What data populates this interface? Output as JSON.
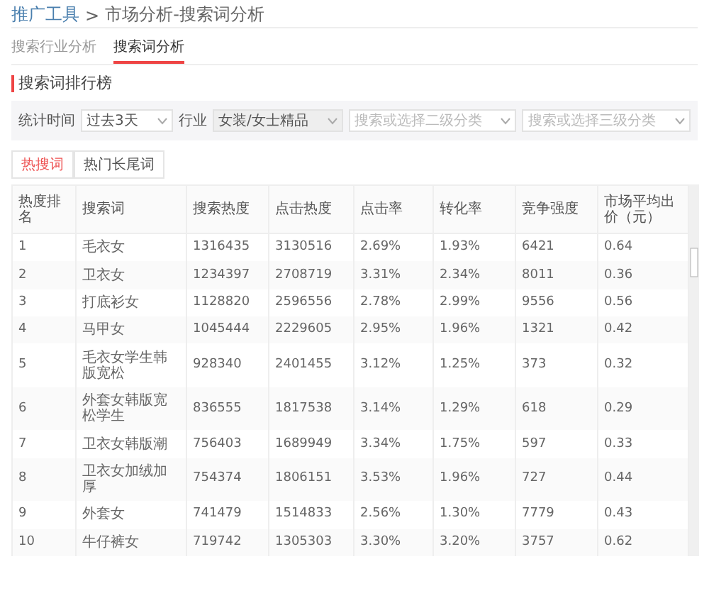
{
  "breadcrumb": {
    "root": "推广工具",
    "separator": ">",
    "current": "市场分析-搜索词分析"
  },
  "tabs": [
    {
      "label": "搜索行业分析",
      "selected": false
    },
    {
      "label": "搜索词分析",
      "selected": true
    }
  ],
  "section_title": "搜索词排行榜",
  "filters": [
    {
      "label": "统计时间",
      "value": "过去3天",
      "highlighted": false
    },
    {
      "label": "行业",
      "value": "女装/女士精品",
      "highlighted": true
    },
    {
      "placeholder": "搜索或选择二级分类",
      "highlighted": false
    },
    {
      "placeholder": "搜索或选择三级分类",
      "highlighted": false
    }
  ],
  "word_tabs": [
    {
      "label": "热搜词",
      "selected": true
    },
    {
      "label": "热门长尾词",
      "selected": false
    }
  ],
  "table": {
    "columns": [
      "热度排名",
      "搜索词",
      "搜索热度",
      "点击热度",
      "点击率",
      "转化率",
      "竞争强度",
      "市场平均出价（元）"
    ],
    "rows": [
      [
        "1",
        "毛衣女",
        "1316435",
        "3130516",
        "2.69%",
        "1.93%",
        "6421",
        "0.64"
      ],
      [
        "2",
        "卫衣女",
        "1234397",
        "2708719",
        "3.31%",
        "2.34%",
        "8011",
        "0.36"
      ],
      [
        "3",
        "打底衫女",
        "1128820",
        "2596556",
        "2.78%",
        "2.99%",
        "9556",
        "0.56"
      ],
      [
        "4",
        "马甲女",
        "1045444",
        "2229605",
        "2.95%",
        "1.96%",
        "1321",
        "0.42"
      ],
      [
        "5",
        "毛衣女学生韩版宽松",
        "928340",
        "2401455",
        "3.12%",
        "1.25%",
        "373",
        "0.32"
      ],
      [
        "6",
        "外套女韩版宽松学生",
        "836555",
        "1817538",
        "3.14%",
        "1.29%",
        "618",
        "0.29"
      ],
      [
        "7",
        "卫衣女韩版潮",
        "756403",
        "1689949",
        "3.34%",
        "1.75%",
        "597",
        "0.33"
      ],
      [
        "8",
        "卫衣女加绒加厚",
        "754374",
        "1806151",
        "3.53%",
        "1.96%",
        "727",
        "0.44"
      ],
      [
        "9",
        "外套女",
        "741479",
        "1514833",
        "2.56%",
        "1.30%",
        "7779",
        "0.43"
      ],
      [
        "10",
        "牛仔裤女",
        "719742",
        "1305303",
        "3.30%",
        "3.20%",
        "3757",
        "0.62"
      ]
    ]
  }
}
